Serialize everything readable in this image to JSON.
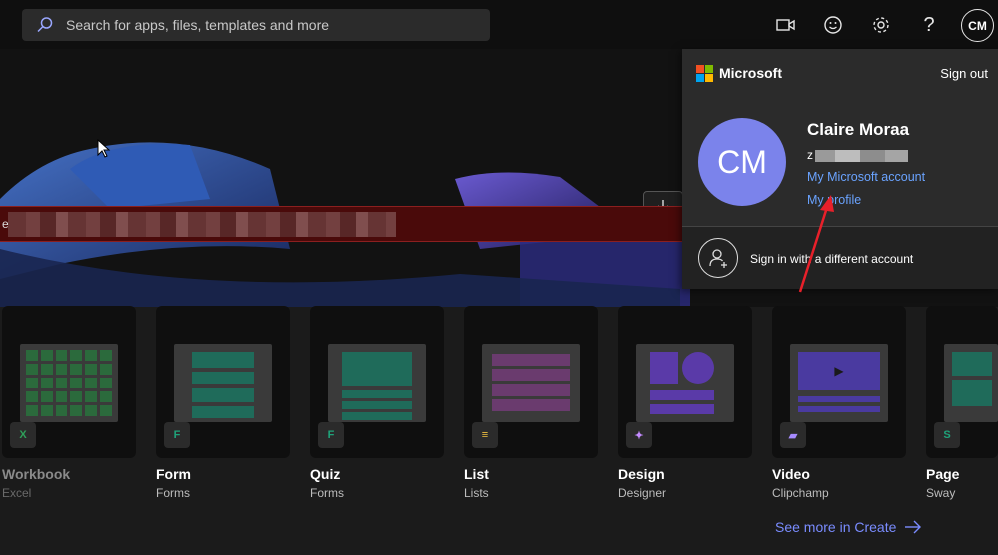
{
  "search": {
    "placeholder": "Search for apps, files, templates and more"
  },
  "topbar": {
    "avatar_initials": "CM",
    "help_glyph": "?"
  },
  "banner": {
    "text": "e"
  },
  "account_panel": {
    "brand": "Microsoft",
    "sign_out": "Sign out",
    "initials": "CM",
    "name": "Claire Moraa",
    "email_prefix": "z",
    "my_account_link": "My Microsoft account",
    "my_profile_link": "My profile",
    "different_account": "Sign in with a different account"
  },
  "cards": [
    {
      "title": "Workbook",
      "app": "Excel",
      "icon": "excel-icon",
      "dim": true
    },
    {
      "title": "Form",
      "app": "Forms",
      "icon": "forms-icon"
    },
    {
      "title": "Quiz",
      "app": "Forms",
      "icon": "forms-icon"
    },
    {
      "title": "List",
      "app": "Lists",
      "icon": "lists-icon"
    },
    {
      "title": "Design",
      "app": "Designer",
      "icon": "designer-icon"
    },
    {
      "title": "Video",
      "app": "Clipchamp",
      "icon": "clipchamp-icon"
    },
    {
      "title": "Page",
      "app": "Sway",
      "icon": "sway-icon"
    }
  ],
  "see_more": "See more in Create",
  "colors": {
    "accent": "#7b83eb",
    "link": "#6aa3ff",
    "annotation": "#e8202a"
  }
}
